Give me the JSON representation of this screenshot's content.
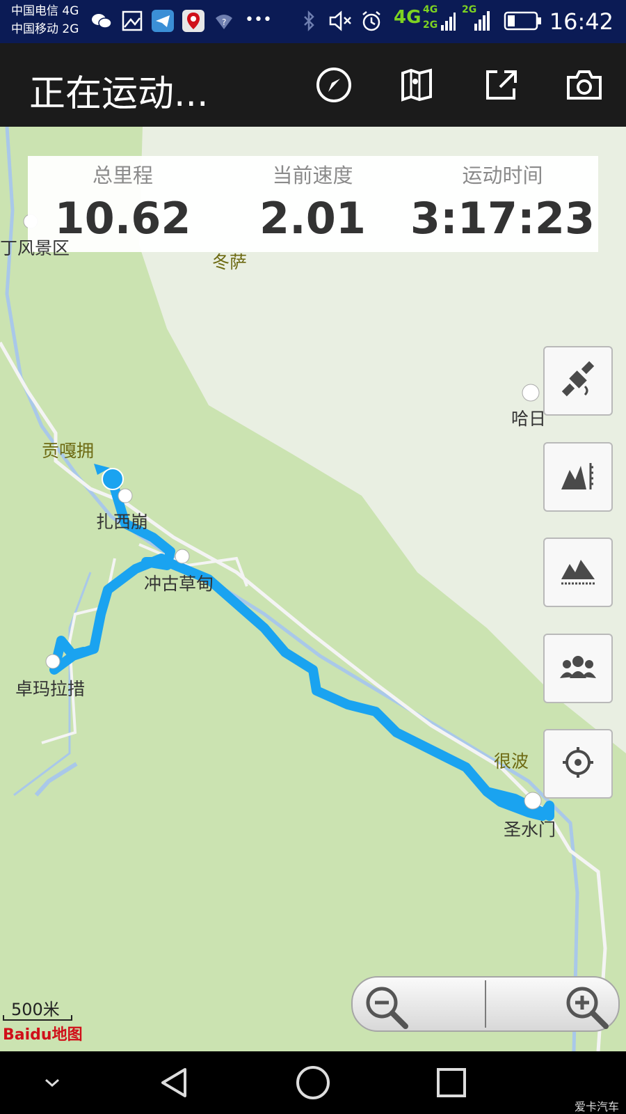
{
  "status_bar": {
    "carrier1": "中国电信 4G",
    "carrier2": "中国移动 2G",
    "net1": "4G",
    "net2a": "4G",
    "net2b": "2G",
    "net3": "2G",
    "time": "16:42"
  },
  "app_bar": {
    "title": "正在运动..."
  },
  "stats": {
    "distance_label": "总里程",
    "distance_value": "10.62",
    "speed_label": "当前速度",
    "speed_value": "2.01",
    "duration_label": "运动时间",
    "duration_value": "3:17:23"
  },
  "map": {
    "places": {
      "p1": "丁风景区",
      "p2": "冬萨",
      "p3": "哈日",
      "p4": "贡嘎拥",
      "p5": "扎西崩",
      "p6": "冲古草甸",
      "p7": "卓玛拉措",
      "p8": "很波",
      "p9": "圣水门"
    },
    "scale": "500米",
    "logo": "Baidu地图"
  },
  "watermark": "爱卡汽车",
  "colors": {
    "track": "#1aa3f0",
    "status_bar": "#0b1b55",
    "app_bar": "#1b1b1b"
  },
  "icons": [
    "navigate-icon",
    "map-book-icon",
    "share-icon",
    "camera-icon",
    "satellite-icon",
    "elevation-chart-icon",
    "mountain-icon",
    "team-icon",
    "locate-icon",
    "zoom-out-icon",
    "zoom-in-icon"
  ]
}
